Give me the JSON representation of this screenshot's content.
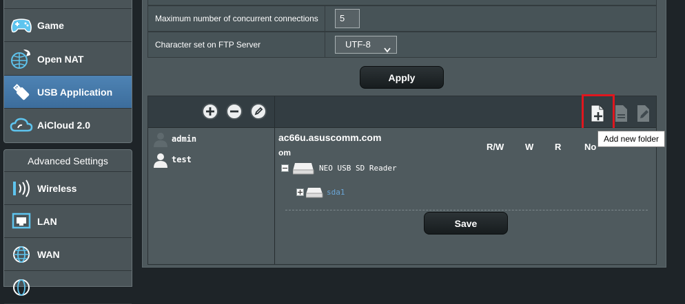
{
  "sidebar": {
    "items": [
      {
        "label": "Game",
        "icon": "gamepad-icon",
        "active": false
      },
      {
        "label": "Open NAT",
        "icon": "open-nat-icon",
        "active": false
      },
      {
        "label": "USB Application",
        "icon": "usb-icon",
        "active": true
      },
      {
        "label": "AiCloud 2.0",
        "icon": "cloud-icon",
        "active": false
      }
    ],
    "advanced": {
      "title": "Advanced Settings",
      "items": [
        {
          "label": "Wireless",
          "icon": "wireless-icon"
        },
        {
          "label": "LAN",
          "icon": "lan-icon"
        },
        {
          "label": "WAN",
          "icon": "globe-icon"
        }
      ]
    }
  },
  "form": {
    "max_conn_label": "Maximum number of concurrent connections",
    "max_conn_value": "5",
    "charset_label": "Character set on FTP Server",
    "charset_value": "UTF-8",
    "apply_label": "Apply"
  },
  "accounts": {
    "users": [
      "admin",
      "test"
    ],
    "host_line1": "ac66u.asuscomm.com",
    "host_line2": "om",
    "permissions": [
      "R/W",
      "W",
      "R",
      "No"
    ],
    "device": "NEO USB  SD Reader",
    "partition": "sda1",
    "save_label": "Save",
    "tooltip": "Add new folder"
  },
  "colors": {
    "accent_blue": "#4e83b4",
    "highlight_red": "#e0161e",
    "link_blue": "#6aa6d8"
  }
}
